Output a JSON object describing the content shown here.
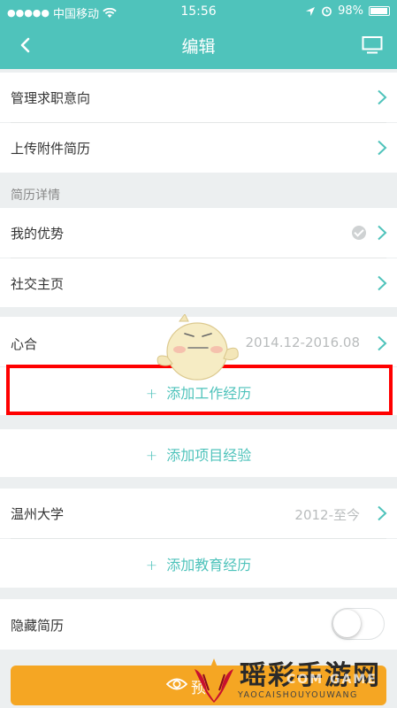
{
  "status_bar": {
    "carrier": "中国移动",
    "time": "15:56",
    "battery": "98%"
  },
  "nav": {
    "title": "编辑"
  },
  "rows": {
    "manage_intent": "管理求职意向",
    "upload_attachment": "上传附件简历"
  },
  "resume_details": {
    "section_title": "简历详情",
    "my_strengths": "我的优势",
    "social_homepage": "社交主页"
  },
  "work": {
    "company": "心合",
    "period": "2014.12-2016.08",
    "add_label": "添加工作经历"
  },
  "project": {
    "add_label": "添加项目经验"
  },
  "education": {
    "school": "温州大学",
    "period": "2012-至今",
    "add_label": "添加教育经历"
  },
  "hide_resume": {
    "label": "隐藏简历",
    "enabled": false
  },
  "preview": {
    "label_fragment": "预"
  },
  "watermark": {
    "brand": "瑶彩手游网",
    "overlay": "COM GAME",
    "pinyin": "YAOCAISHOUYOUWANG"
  },
  "colors": {
    "accent": "#4fc3bb",
    "highlight": "#ff0000",
    "button": "#f5a623",
    "chevron": "#4fc3bb"
  },
  "icons": [
    "back-icon",
    "preview-screen-icon",
    "chevron-right-icon",
    "check-circle-icon",
    "plus-icon",
    "eye-icon",
    "wifi-icon",
    "location-icon",
    "alarm-icon",
    "battery-icon"
  ]
}
